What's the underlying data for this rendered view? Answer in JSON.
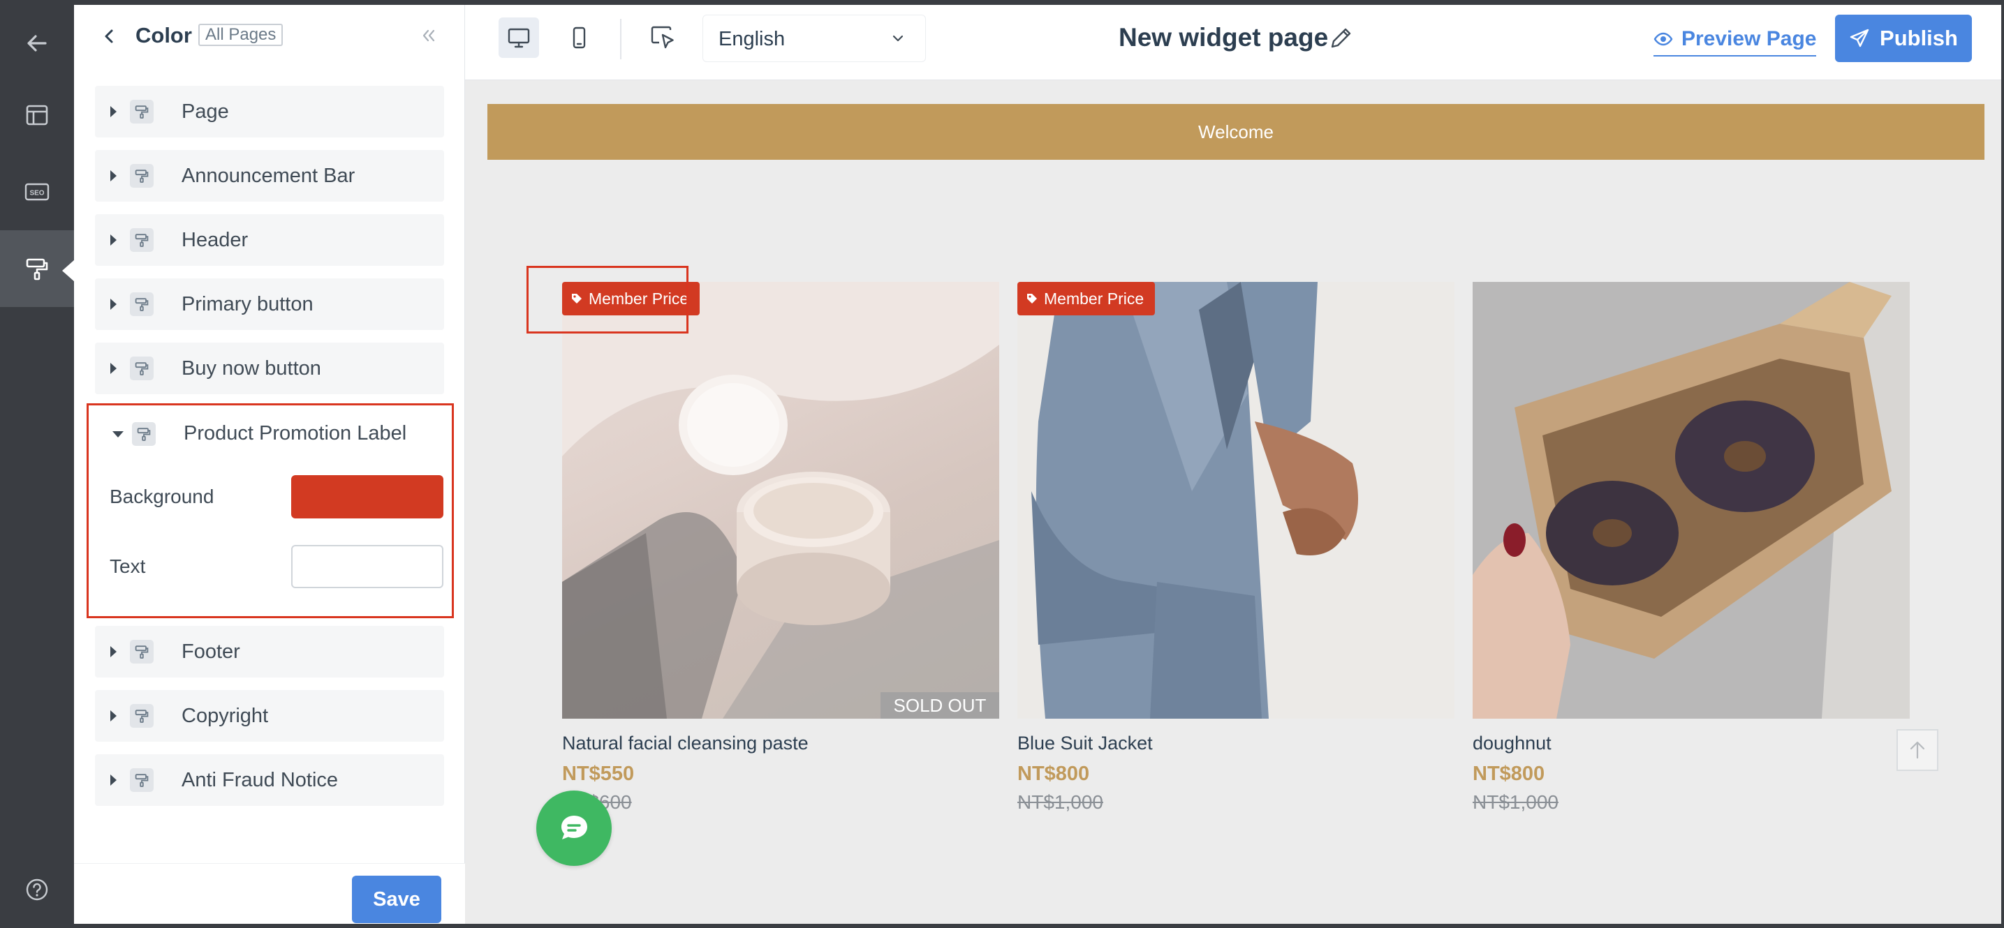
{
  "rail": {
    "items": [
      {
        "name": "back",
        "icon": "arrow-left-icon"
      },
      {
        "name": "layout",
        "icon": "layout-icon"
      },
      {
        "name": "seo",
        "icon": "seo-icon",
        "text": "SEO"
      },
      {
        "name": "design",
        "icon": "paint-roller-icon",
        "active": true
      },
      {
        "name": "help",
        "icon": "help-icon"
      }
    ]
  },
  "panel": {
    "title": "Color",
    "scope": "All Pages",
    "sections": [
      {
        "label": "Page"
      },
      {
        "label": "Announcement Bar"
      },
      {
        "label": "Header"
      },
      {
        "label": "Primary button"
      },
      {
        "label": "Buy now button"
      }
    ],
    "promo": {
      "label": "Product Promotion Label",
      "fields": [
        {
          "label": "Background",
          "color": "#d23a22"
        },
        {
          "label": "Text",
          "color": "#ffffff"
        }
      ]
    },
    "sections_after": [
      {
        "label": "Footer"
      },
      {
        "label": "Copyright"
      },
      {
        "label": "Anti Fraud Notice"
      }
    ],
    "save_label": "Save"
  },
  "toolbar": {
    "language": "English",
    "page_title": "New widget page",
    "preview_label": "Preview Page",
    "publish_label": "Publish"
  },
  "canvas": {
    "announcement": "Welcome",
    "products": [
      {
        "name": "Natural facial cleansing paste",
        "price": "NT$550",
        "old_price": "NT$600",
        "badge": "Member Price",
        "sold_out": "SOLD OUT"
      },
      {
        "name": "Blue Suit Jacket",
        "price": "NT$800",
        "old_price": "NT$1,000",
        "badge": "Member Price"
      },
      {
        "name": "doughnut",
        "price": "NT$800",
        "old_price": "NT$1,000"
      }
    ]
  },
  "colors": {
    "accent": "#4a86e0",
    "brand_gold": "#c19a5b",
    "promo_label": "#d23a22",
    "chat": "#3fb862"
  }
}
